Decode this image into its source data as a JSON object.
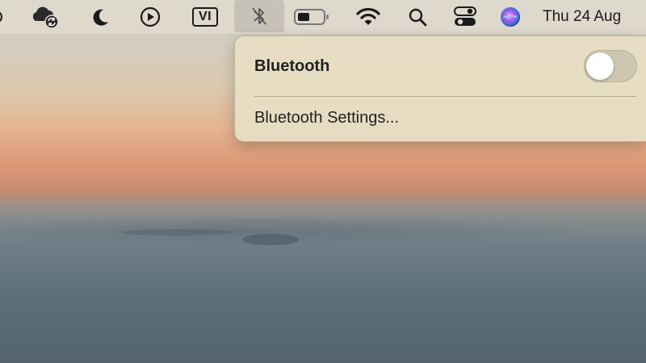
{
  "menubar": {
    "vi_label": "VI",
    "clock": "Thu 24 Aug"
  },
  "bluetooth_menu": {
    "title": "Bluetooth",
    "toggle_on": false,
    "settings_label": "Bluetooth Settings..."
  }
}
